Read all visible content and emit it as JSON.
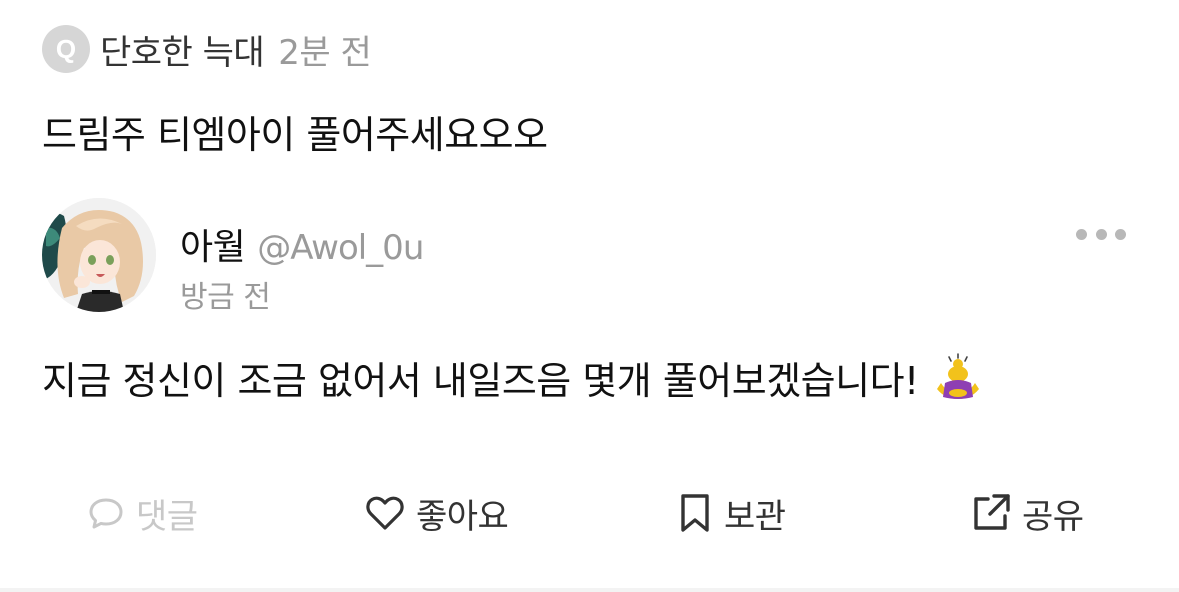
{
  "question": {
    "badge": "Q",
    "author": "단호한 늑대",
    "time": "2분 전",
    "title": "드림주 티엠아이 풀어주세요오오"
  },
  "answer": {
    "author_name": "아월",
    "handle": "@Awol_0u",
    "time": "방금 전",
    "body": "지금 정신이 조금 없어서 내일즈음 몇개 풀어보겠습니다!",
    "emoji_icon": "person-bowing-emoji"
  },
  "actions": {
    "comment_label": "댓글",
    "like_label": "좋아요",
    "bookmark_label": "보관",
    "share_label": "공유"
  },
  "colors": {
    "text_primary": "#111111",
    "text_secondary": "#9a9a9a",
    "disabled": "#c8c8c8",
    "badge_bg": "#d6d6d6"
  }
}
